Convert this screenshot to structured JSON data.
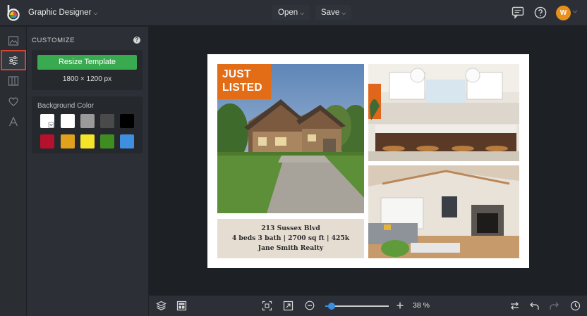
{
  "header": {
    "app_title": "Graphic Designer",
    "open_label": "Open",
    "save_label": "Save",
    "avatar_initial": "W"
  },
  "sidebar": {
    "items": [
      {
        "name": "image-icon"
      },
      {
        "name": "sliders-icon",
        "active": true
      },
      {
        "name": "columns-icon"
      },
      {
        "name": "heart-icon"
      },
      {
        "name": "text-icon"
      }
    ]
  },
  "panel": {
    "title": "CUSTOMIZE",
    "resize_button": "Resize Template",
    "dimensions": "1800 × 1200 px",
    "background_label": "Background Color",
    "swatches": [
      "#ffffff",
      "#ffffff",
      "#9a9a9a",
      "#4a4a4a",
      "#000000",
      "#b5112d",
      "#e0a21d",
      "#f4e42a",
      "#3f8d20",
      "#3f8fe0"
    ]
  },
  "flyer": {
    "badge_line1": "JUST",
    "badge_line2": "LISTED",
    "address": "213 Sussex Blvd",
    "details": "4 beds 3 bath | 2700 sq ft | 425k",
    "agent": "Jane Smith Realty"
  },
  "footer": {
    "zoom_percent": "38 %",
    "zoom_level": 0.1
  },
  "colors": {
    "accent_green": "#3aaa50",
    "accent_orange": "#e26d16",
    "active_outline": "#d8432f",
    "slider_blue": "#3b8fe0"
  }
}
